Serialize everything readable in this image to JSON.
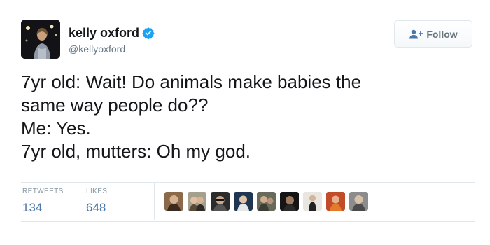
{
  "user": {
    "name": "kelly oxford",
    "handle": "@kellyoxford"
  },
  "follow_button": {
    "label": "Follow"
  },
  "tweet": {
    "lines": [
      "7yr old: Wait! Do animals make babies the",
      "same way people do??",
      "Me: Yes.",
      "7yr old, mutters: Oh my god."
    ]
  },
  "stats": {
    "retweets_label": "RETWEETS",
    "retweets_count": "134",
    "likes_label": "LIKES",
    "likes_count": "648"
  },
  "likers_count_shown": 9,
  "colors": {
    "verified": "#1da1f2",
    "count": "#4a76a8",
    "muted": "#657786",
    "divider": "#e1e8ed"
  },
  "icons": {
    "verified": "verified-badge-icon",
    "follow": "person-add-icon"
  }
}
